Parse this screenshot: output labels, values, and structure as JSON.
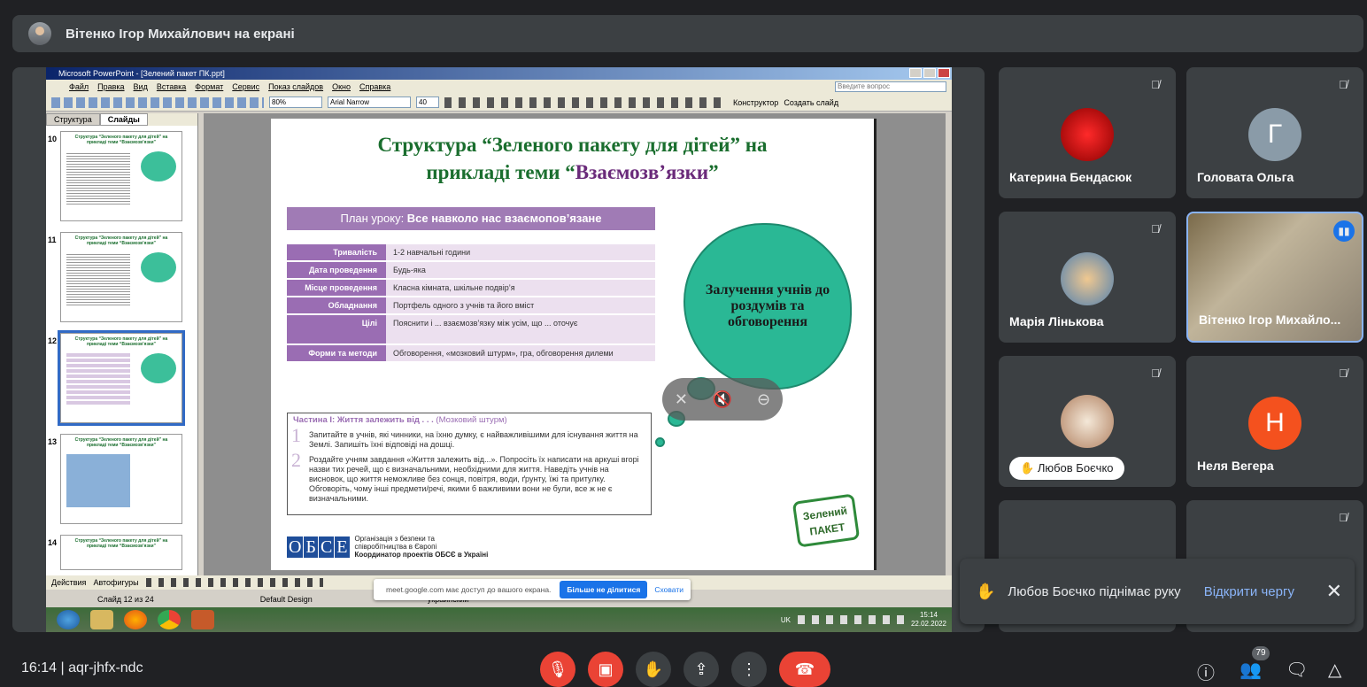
{
  "top_bar": {
    "presenting_label": "Вітенко Ігор Михайлович на екрані"
  },
  "ppt": {
    "window_title": "Microsoft PowerPoint - [Зелений пакет ПК.ppt]",
    "menu": [
      "Файл",
      "Правка",
      "Вид",
      "Вставка",
      "Формат",
      "Сервис",
      "Показ слайдов",
      "Окно",
      "Справка"
    ],
    "ask_question_placeholder": "Введите вопрос",
    "zoom": "80%",
    "font_name": "Arial Narrow",
    "font_size": "40",
    "designer_label": "Конструктор",
    "new_slide_label": "Создать слайд",
    "pane_tabs": [
      "Структура",
      "Слайды"
    ],
    "thumb_numbers": [
      "10",
      "11",
      "12",
      "13",
      "14"
    ],
    "thumb_title": "Структура “Зеленого пакету для дітей” на прикладі теми “Взаємозв’язки”",
    "slide": {
      "title_line1": "Структура “Зеленого пакету для дітей” на",
      "title_line2": "прикладі теми “",
      "title_purple": "Взаємозв’язки",
      "title_end": "”",
      "plan_prefix": "План уроку: ",
      "plan_bold": "Все навколо нас взаємопов’язане",
      "table": [
        {
          "k": "Тривалість",
          "v": "1-2 навчальні години"
        },
        {
          "k": "Дата проведення",
          "v": "Будь-яка"
        },
        {
          "k": "Місце проведення",
          "v": "Класна кімната, шкільне подвір’я"
        },
        {
          "k": "Обладнання",
          "v": "Портфель одного з учнів та його вміст"
        },
        {
          "k": "Цілі",
          "v": "Пояснити і ... взаємозв’язку між усім, що ... оточує"
        },
        {
          "k": "Форми та методи",
          "v": "Обговорення, «мозковий штурм», гра, обговорення дилеми"
        }
      ],
      "part_heading_bold": "Частина І: Життя залежить від . . .",
      "part_heading_rest": " (Мозковий штурм)",
      "part_item1_num": "1",
      "part_item1": "Запитайте в учнів, які чинники, на їхню думку, є найважливішими для існування життя на Землі. Запишіть їхні відповіді на дошці.",
      "part_item2_num": "2",
      "part_item2": "Роздайте учням завдання «Життя залежить від...». Попросіть їх написати на аркуші вгорі назви тих речей, що є визначальними, необхідними для життя. Наведіть учнів на висновок, що життя неможливе без сонця, повітря, води, ґрунту, їжі та притулку. Обговоріть, чому інші предмети/речі, якими б важливими вони не були, все ж не є визначальними.",
      "cloud_text": "Залучення учнів до роздумів та обговорення",
      "osce_letters": [
        "О",
        "Б",
        "С",
        "Е"
      ],
      "osce_line1": "Організація з безпеки та",
      "osce_line2": "співробітництва в Європі",
      "osce_line3": "Координатор проектів ОБСЄ в Україні",
      "green_pack_line1": "Зелений",
      "green_pack_line2": "ПАКЕТ"
    },
    "draw_actions": "Действия",
    "autoshapes": "Автофигуры",
    "status_slide": "Слайд 12 из 24",
    "status_design": "Default Design",
    "status_lang": "украинский",
    "tray_lang": "UK",
    "tray_time": "15:14",
    "tray_date": "22.02.2022"
  },
  "meet_banner": {
    "text": "meet.google.com має доступ до вашого екрана.",
    "stop_label": "Більше не ділитися",
    "hide_label": "Сховати"
  },
  "participants": [
    {
      "name": "Катерина Бендасюк",
      "initial": ""
    },
    {
      "name": "Головата Ольга",
      "initial": "Г"
    },
    {
      "name": "Марія Лінькова",
      "initial": ""
    },
    {
      "name": "Вітенко Ігор Михайло...",
      "initial": ""
    },
    {
      "name": "Любов Боєчко",
      "initial": ""
    },
    {
      "name": "Неля Вегера",
      "initial": "Н"
    }
  ],
  "notification": {
    "message": "Любов Боєчко піднімає руку",
    "link": "Відкрити чергу"
  },
  "bottom": {
    "time": "16:14",
    "meeting_code": "aqr-jhfx-ndc",
    "participant_count": "79"
  },
  "colors": {
    "red": "#ea4335",
    "blue_link": "#8ab4f8",
    "surface": "#3c4043",
    "bg": "#202124"
  }
}
